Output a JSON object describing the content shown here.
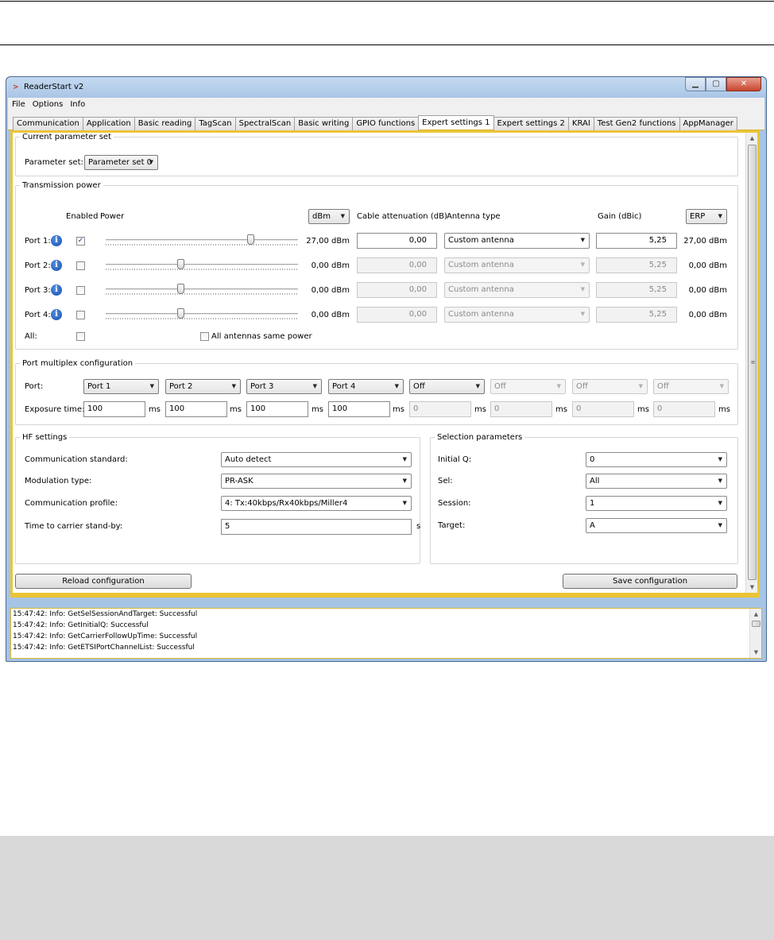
{
  "window": {
    "title": "ReaderStart v2",
    "buttons": {
      "minimize": "▁",
      "maximize": "▢",
      "close": "✕"
    }
  },
  "menu": [
    "File",
    "Options",
    "Info"
  ],
  "tabs": [
    "Communication",
    "Application",
    "Basic reading",
    "TagScan",
    "SpectralScan",
    "Basic writing",
    "GPIO functions",
    "Expert settings 1",
    "Expert settings 2",
    "KRAI",
    "Test Gen2 functions",
    "AppManager"
  ],
  "active_tab": "Expert settings 1",
  "param_set": {
    "legend": "Current parameter set",
    "label": "Parameter set:",
    "value": "Parameter set 0"
  },
  "tx_power": {
    "legend": "Transmission power",
    "col_enabled": "Enabled",
    "col_power": "Power",
    "unit_select": "dBm",
    "col_cable": "Cable attenuation (dB)",
    "col_antenna": "Antenna type",
    "col_gain": "Gain (dBic)",
    "erp_select": "ERP",
    "ports": [
      {
        "label": "Port 1:",
        "checked": "✓",
        "slider_fraction": 0.75,
        "power": "27,00 dBm",
        "cable": "0,00",
        "antenna": "Custom antenna",
        "gain": "5,25",
        "erp": "27,00 dBm"
      },
      {
        "label": "Port 2:",
        "checked": "",
        "slider_fraction": 0.39,
        "power": "0,00 dBm",
        "cable": "0,00",
        "antenna": "Custom antenna",
        "gain": "5,25",
        "erp": "0,00 dBm"
      },
      {
        "label": "Port 3:",
        "checked": "",
        "slider_fraction": 0.39,
        "power": "0,00 dBm",
        "cable": "0,00",
        "antenna": "Custom antenna",
        "gain": "5,25",
        "erp": "0,00 dBm"
      },
      {
        "label": "Port 4:",
        "checked": "",
        "slider_fraction": 0.39,
        "power": "0,00 dBm",
        "cable": "0,00",
        "antenna": "Custom antenna",
        "gain": "5,25",
        "erp": "0,00 dBm"
      }
    ],
    "all_label": "All:",
    "all_checked": "",
    "same_power_label": "All antennas same power",
    "same_power_checked": ""
  },
  "multiplex": {
    "legend": "Port multiplex configuration",
    "port_label": "Port:",
    "exposure_label": "Exposure time:",
    "unit": "ms",
    "slots": [
      {
        "port": "Port 1",
        "time": "100"
      },
      {
        "port": "Port 2",
        "time": "100"
      },
      {
        "port": "Port 3",
        "time": "100"
      },
      {
        "port": "Port 4",
        "time": "100"
      },
      {
        "port": "Off",
        "time": "0"
      },
      {
        "port": "Off",
        "time": "0"
      },
      {
        "port": "Off",
        "time": "0"
      },
      {
        "port": "Off",
        "time": "0"
      }
    ]
  },
  "hf": {
    "legend": "HF settings",
    "standard_label": "Communication standard:",
    "standard": "Auto detect",
    "modulation_label": "Modulation type:",
    "modulation": "PR-ASK",
    "profile_label": "Communication profile:",
    "profile": "4: Tx:40kbps/Rx40kbps/Miller4",
    "standby_label": "Time to carrier stand-by:",
    "standby": "5",
    "standby_unit": "s"
  },
  "selection": {
    "legend": "Selection parameters",
    "q_label": "Initial Q:",
    "q": "0",
    "sel_label": "Sel:",
    "sel": "All",
    "session_label": "Session:",
    "session": "1",
    "target_label": "Target:",
    "target": "A"
  },
  "buttons": {
    "reload": "Reload configuration",
    "save": "Save configuration"
  },
  "log": [
    "15:47:42: Info: GetSelSessionAndTarget: Successful",
    "15:47:42: Info: GetInitialQ: Successful",
    "15:47:42: Info: GetCarrierFollowUpTime: Successful",
    "15:47:42: Info: GetETSIPortChannelList: Successful"
  ],
  "icons": {
    "dropdown": "▼",
    "info": "i",
    "scroll_up": "▲",
    "scroll_down": "▼",
    "grip": "≡"
  }
}
